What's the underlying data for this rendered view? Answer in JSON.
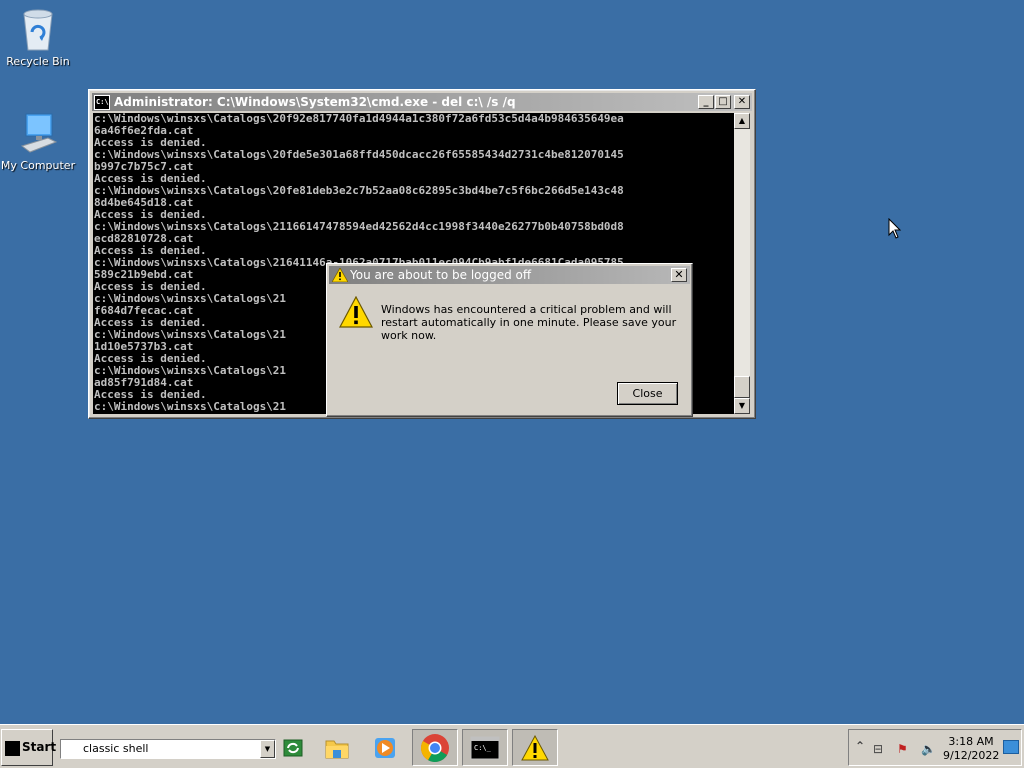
{
  "desktop": {
    "icons": [
      {
        "label": "Recycle Bin"
      },
      {
        "label": "My Computer"
      }
    ]
  },
  "console_window": {
    "title": "Administrator: C:\\Windows\\System32\\cmd.exe - del  c:\\ /s /q",
    "lines": [
      "c:\\Windows\\winsxs\\Catalogs\\20f92e817740fa1d4944a1c380f72a6fd53c5d4a4b984635649ea",
      "6a46f6e2fda.cat",
      "Access is denied.",
      "c:\\Windows\\winsxs\\Catalogs\\20fde5e301a68ffd450dcacc26f65585434d2731c4be812070145",
      "b997c7b75c7.cat",
      "Access is denied.",
      "c:\\Windows\\winsxs\\Catalogs\\20fe81deb3e2c7b52aa08c62895c3bd4be7c5f6bc266d5e143c48",
      "8d4be645d18.cat",
      "Access is denied.",
      "c:\\Windows\\winsxs\\Catalogs\\21166147478594ed42562d4cc1998f3440e26277b0b40758bd0d8",
      "ecd82810728.cat",
      "Access is denied.",
      "c:\\Windows\\winsxs\\Catalogs\\21641146a-1062a0717bab011ec094Cb9abf1de6681Cada095785",
      "589c21b9ebd.cat",
      "Access is denied.",
      "c:\\Windows\\winsxs\\Catalogs\\21                                              efecd",
      "f684d7fecac.cat",
      "Access is denied.",
      "c:\\Windows\\winsxs\\Catalogs\\21                                              b2741",
      "1d10e5737b3.cat",
      "Access is denied.",
      "c:\\Windows\\winsxs\\Catalogs\\21                                              b2a1d",
      "ad85f791d84.cat",
      "Access is denied.",
      "c:\\Windows\\winsxs\\Catalogs\\21                                              f2710"
    ]
  },
  "dialog": {
    "title": "You are about to be logged off",
    "message": "Windows has encountered a critical problem and will restart automatically in one minute. Please save your work now.",
    "close_label": "Close"
  },
  "taskbar": {
    "start_label": "Start",
    "search_value": "classic shell",
    "apps": [
      {
        "icon": "switch-windows-icon"
      },
      {
        "icon": "file-explorer-icon"
      },
      {
        "icon": "media-player-icon"
      },
      {
        "icon": "chrome-icon"
      },
      {
        "icon": "command-prompt-icon"
      },
      {
        "icon": "warning-icon"
      }
    ],
    "clock_time": "3:18 AM",
    "clock_date": "9/12/2022"
  },
  "colors": {
    "desktop": "#3a6ea5",
    "warning_yellow": "#ffd800"
  }
}
